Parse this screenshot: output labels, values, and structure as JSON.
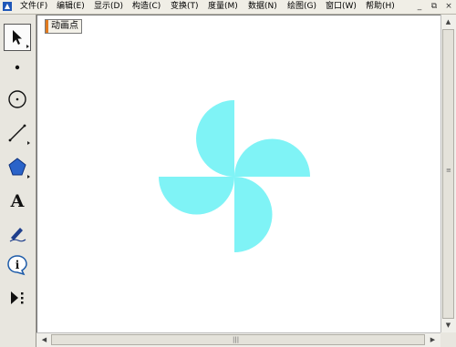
{
  "menu": {
    "items": [
      "文件(F)",
      "编辑(E)",
      "显示(D)",
      "构造(C)",
      "变换(T)",
      "度量(M)",
      "数据(N)",
      "绘图(G)",
      "窗口(W)",
      "帮助(H)"
    ]
  },
  "window_controls": {
    "minimize": "_",
    "restore": "⧉",
    "close": "×"
  },
  "canvas": {
    "animate_button_label": "动画点"
  },
  "figure": {
    "fill_color": "#7ff3f6"
  },
  "tools": [
    "move-arrow",
    "point",
    "compass",
    "straightedge",
    "polygon",
    "text",
    "marker",
    "information",
    "custom"
  ],
  "scrollbars": {
    "vertical_grip": "≡",
    "horizontal_grip": "|||"
  }
}
